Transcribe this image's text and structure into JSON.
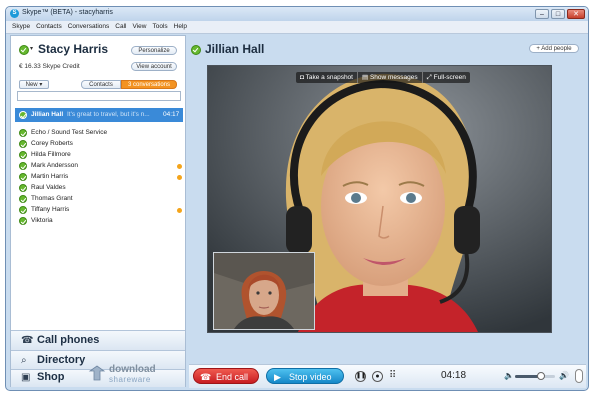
{
  "app": {
    "title": "Skype™ (BETA) - stacyharris"
  },
  "menu": [
    "Skype",
    "Contacts",
    "Conversations",
    "Call",
    "View",
    "Tools",
    "Help"
  ],
  "profile": {
    "name": "Stacy Harris",
    "personalize_label": "Personalize",
    "credit": "€ 16.33 Skype Credit",
    "view_account_label": "View account"
  },
  "list_controls": {
    "new_label": "New",
    "contacts_tab": "Contacts",
    "conversations_tab": "3 conversations"
  },
  "active_conversation": {
    "name": "Jillian Hall",
    "message": "It's great to travel, but it's n...",
    "time": "04:17"
  },
  "contacts": [
    {
      "name": "Echo / Sound Test Service",
      "unread": false
    },
    {
      "name": "Corey Roberts",
      "unread": false
    },
    {
      "name": "Hilda Fillmore",
      "unread": false
    },
    {
      "name": "Mark Andersson",
      "unread": true
    },
    {
      "name": "Martin Harris",
      "unread": true
    },
    {
      "name": "Raul Valdes",
      "unread": false
    },
    {
      "name": "Thomas Grant",
      "unread": false
    },
    {
      "name": "Tiffany Harris",
      "unread": true
    },
    {
      "name": "Viktoria",
      "unread": false
    }
  ],
  "bottom_nav": {
    "call_phones": "Call phones",
    "directory": "Directory",
    "shop": "Shop"
  },
  "watermark": {
    "line1": "download",
    "line2": "shareware"
  },
  "call": {
    "contact_name": "Jillian Hall",
    "add_people_label": "+ Add people",
    "snapshot_label": "Take a snapshot",
    "show_messages_label": "Show messages",
    "fullscreen_label": "Full-screen",
    "end_call_label": "End call",
    "stop_video_label": "Stop video",
    "timer": "04:18",
    "volume_level": 0.65
  },
  "colors": {
    "online_green": "#66b82e",
    "accent_blue": "#1e8fd6",
    "end_call_red": "#e0262a",
    "stop_video_blue": "#1ea1de",
    "unread_orange": "#f4a41a",
    "selected_row": "#3a8ad8"
  },
  "icons": {
    "window_minimize": "minimize-icon",
    "window_maximize": "maximize-icon",
    "window_close": "close-icon",
    "phone": "phone-icon",
    "search": "search-icon",
    "shop": "shop-icon"
  }
}
